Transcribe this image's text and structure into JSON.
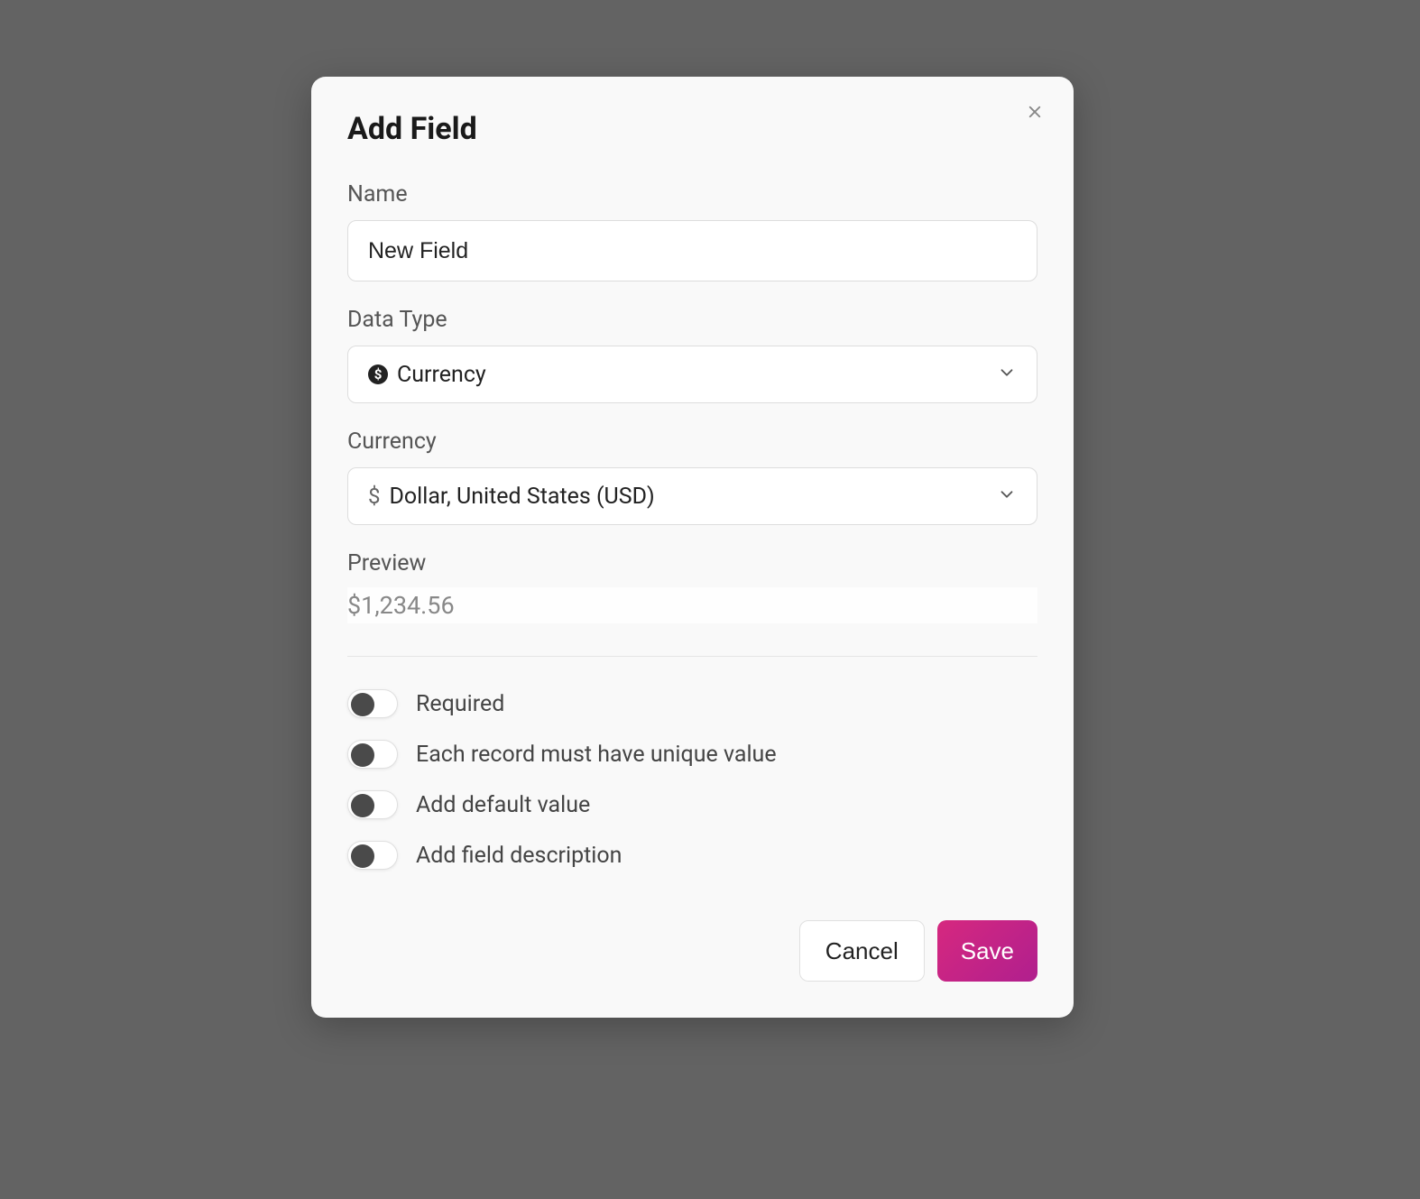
{
  "modal": {
    "title": "Add Field",
    "fields": {
      "name": {
        "label": "Name",
        "value": "New Field"
      },
      "dataType": {
        "label": "Data Type",
        "value": "Currency"
      },
      "currency": {
        "label": "Currency",
        "symbol": "$",
        "value": "Dollar, United States (USD)"
      },
      "preview": {
        "label": "Preview",
        "value": "$1,234.56"
      }
    },
    "toggles": [
      {
        "label": "Required"
      },
      {
        "label": "Each record must have unique value"
      },
      {
        "label": "Add default value"
      },
      {
        "label": "Add field description"
      }
    ],
    "buttons": {
      "cancel": "Cancel",
      "save": "Save"
    }
  }
}
